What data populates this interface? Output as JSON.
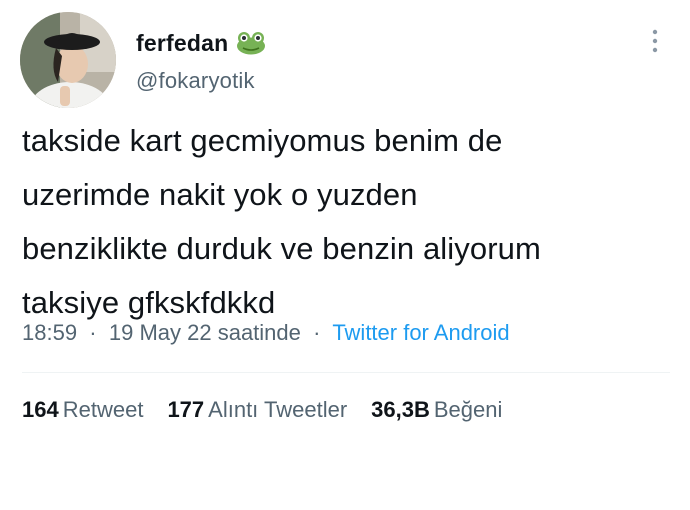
{
  "author": {
    "display_name": "ferfedan",
    "handle": "@fokaryotik",
    "name_emoji": "frog-face-icon"
  },
  "tweet": {
    "lines": [
      "takside kart gecmiyomus benim de",
      "uzerimde nakit yok o yuzden",
      "benziklikte durduk ve benzin aliyorum",
      "taksiye gfkskfdkkd"
    ]
  },
  "meta": {
    "time": "18:59",
    "separator": "·",
    "date": "19 May 22 saatinde",
    "source": "Twitter for Android"
  },
  "stats": {
    "retweets": {
      "count": "164",
      "label": "Retweet"
    },
    "quotes": {
      "count": "177",
      "label": "Alıntı Tweetler"
    },
    "likes": {
      "count": "36,3B",
      "label": "Beğeni"
    }
  },
  "colors": {
    "text": "#0f1419",
    "secondary": "#536471",
    "link": "#1d9bf0",
    "divider": "#eff3f4"
  }
}
